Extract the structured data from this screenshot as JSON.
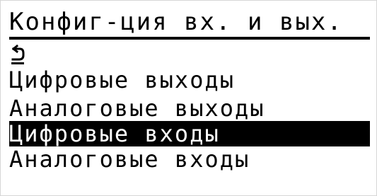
{
  "screen": {
    "title": "Конфиг-ция вх. и вых.",
    "back_icon": "back-arrow-icon",
    "menu": [
      {
        "label": "Цифровые выходы",
        "selected": false
      },
      {
        "label": "Аналоговые выходы",
        "selected": false
      },
      {
        "label": "Цифровые входы",
        "selected": true
      },
      {
        "label": "Аналоговые входы",
        "selected": false
      }
    ]
  },
  "colors": {
    "foreground": "#000000",
    "background": "#ffffff",
    "selection_background": "#000000",
    "selection_text": "#ffffff"
  }
}
